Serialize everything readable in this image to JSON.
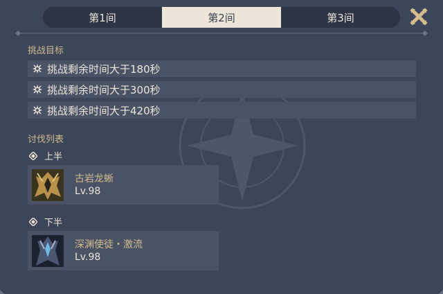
{
  "tabs": [
    {
      "label": "第1间",
      "active": false
    },
    {
      "label": "第2间",
      "active": true
    },
    {
      "label": "第3间",
      "active": false
    }
  ],
  "close_icon": "close-x-icon",
  "goals": {
    "title": "挑战目标",
    "items": [
      {
        "icon": "star-icon",
        "text": "挑战剩余时间大于180秒"
      },
      {
        "icon": "star-icon",
        "text": "挑战剩余时间大于300秒"
      },
      {
        "icon": "star-icon",
        "text": "挑战剩余时间大于420秒"
      }
    ]
  },
  "enemies": {
    "title": "讨伐列表",
    "first_half": {
      "label": "上半",
      "enemy": {
        "name": "古岩龙蜥",
        "level": "Lv.98"
      }
    },
    "second_half": {
      "label": "下半",
      "enemy": {
        "name": "深渊使徒・激流",
        "level": "Lv.98"
      }
    }
  },
  "colors": {
    "background": "#3d4558",
    "row": "#4a5266",
    "accent_gold": "#d3bc8e",
    "text_light": "#ece5d8",
    "tab_active": "#ece5d8"
  }
}
